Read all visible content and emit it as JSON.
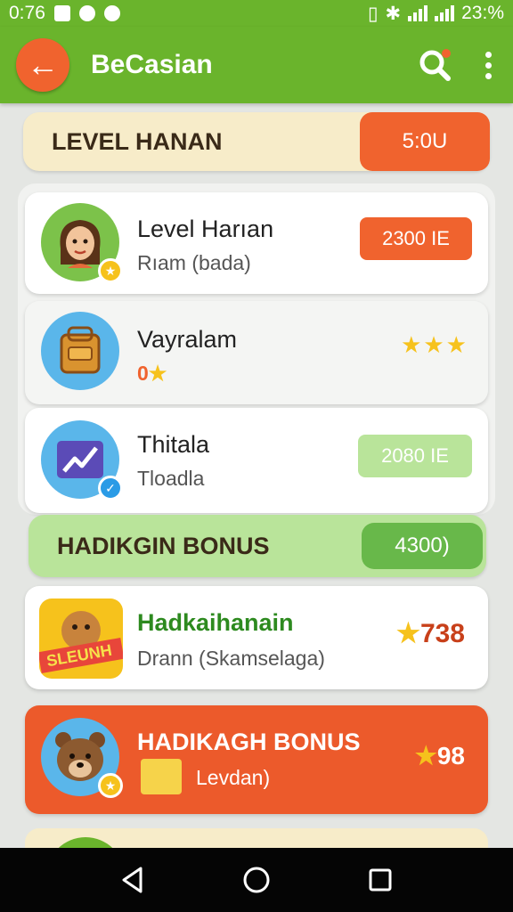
{
  "status_bar": {
    "time": "0:76",
    "battery": "23:%"
  },
  "app_bar": {
    "title": "BeCasian"
  },
  "level_section": {
    "title": "LEVEL HANAN",
    "value": "5:0U"
  },
  "items": [
    {
      "title": "Level Harıan",
      "subtitle": "Rıam (bada)",
      "value": "2300 IE"
    },
    {
      "title": "Vayralam",
      "subtitle": "0",
      "rating": "★★★"
    },
    {
      "title": "Thitala",
      "subtitle": "Tloadla",
      "value": "2080 IE"
    }
  ],
  "bonus_section": {
    "title": "HADIKGIN BONUS",
    "value": "4300)"
  },
  "bonus_items": [
    {
      "title": "Hadkaihanain",
      "subtitle": "Drann (Skamselaga)",
      "score": "738",
      "sticker": "SLEUNH"
    },
    {
      "title": "HADIKAGH BONUS",
      "subtitle": "Levdan)",
      "score": "98"
    }
  ],
  "colors": {
    "green": "#6ab42c",
    "orange": "#f0632e",
    "light_green": "#b9e49a",
    "cream": "#f7ecc9"
  }
}
